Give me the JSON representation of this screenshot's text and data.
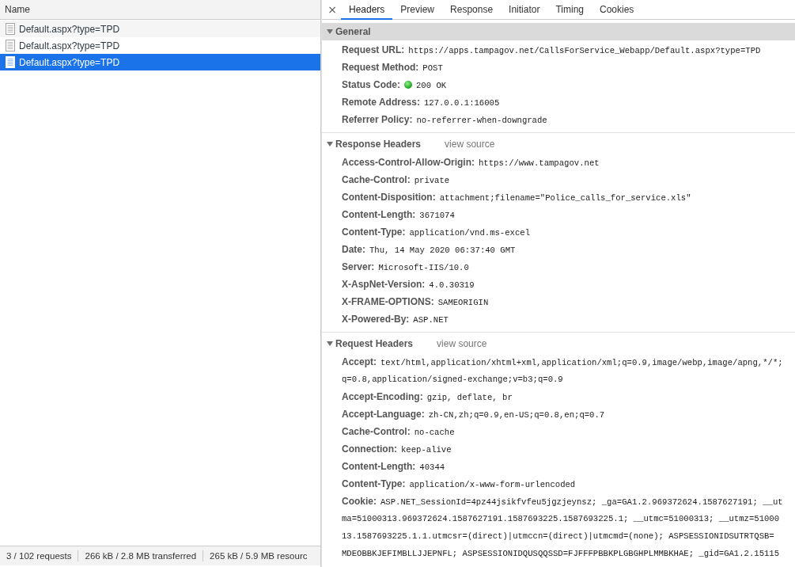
{
  "request_list": {
    "column_header": "Name",
    "requests": [
      {
        "name": "Default.aspx?type=TPD",
        "selected": false
      },
      {
        "name": "Default.aspx?type=TPD",
        "selected": false
      },
      {
        "name": "Default.aspx?type=TPD",
        "selected": true
      }
    ]
  },
  "status_bar": {
    "items": [
      "3 / 102 requests",
      "266 kB / 2.8 MB transferred",
      "265 kB / 5.9 MB resourc"
    ]
  },
  "details": {
    "close_button": "×",
    "tabs": [
      {
        "label": "Headers",
        "selected": true
      },
      {
        "label": "Preview",
        "selected": false
      },
      {
        "label": "Response",
        "selected": false
      },
      {
        "label": "Initiator",
        "selected": false
      },
      {
        "label": "Timing",
        "selected": false
      },
      {
        "label": "Cookies",
        "selected": false
      }
    ],
    "sections": [
      {
        "title": "General",
        "expanded": true,
        "selected": true,
        "rows": [
          {
            "kind": "plain",
            "name": "Request URL:",
            "value": "https://apps.tampagov.net/CallsForService_Webapp/Default.aspx?type=TPD"
          },
          {
            "kind": "plain",
            "name": "Request Method:",
            "value": "POST"
          },
          {
            "kind": "status",
            "name": "Status Code:",
            "value": "200 OK"
          },
          {
            "kind": "plain",
            "name": "Remote Address:",
            "value": "127.0.0.1:16005"
          },
          {
            "kind": "plain",
            "name": "Referrer Policy:",
            "value": "no-referrer-when-downgrade"
          }
        ]
      },
      {
        "title": "Response Headers",
        "link": "view source",
        "expanded": true,
        "selected": false,
        "rows": [
          {
            "kind": "plain",
            "name": "Access-Control-Allow-Origin:",
            "value": "https://www.tampagov.net"
          },
          {
            "kind": "plain",
            "name": "Cache-Control:",
            "value": "private"
          },
          {
            "kind": "plain",
            "name": "Content-Disposition:",
            "value": "attachment;filename=\"Police_calls_for_service.xls\""
          },
          {
            "kind": "plain",
            "name": "Content-Length:",
            "value": "3671074"
          },
          {
            "kind": "plain",
            "name": "Content-Type:",
            "value": "application/vnd.ms-excel"
          },
          {
            "kind": "plain",
            "name": "Date:",
            "value": "Thu, 14 May 2020 06:37:40 GMT"
          },
          {
            "kind": "plain",
            "name": "Server:",
            "value": "Microsoft-IIS/10.0"
          },
          {
            "kind": "plain",
            "name": "X-AspNet-Version:",
            "value": "4.0.30319"
          },
          {
            "kind": "plain",
            "name": "X-FRAME-OPTIONS:",
            "value": "SAMEORIGIN"
          },
          {
            "kind": "plain",
            "name": "X-Powered-By:",
            "value": "ASP.NET"
          }
        ]
      },
      {
        "title": "Request Headers",
        "link": "view source",
        "expanded": true,
        "selected": false,
        "rows": [
          {
            "kind": "plain",
            "name": "Accept:",
            "value": "text/html,application/xhtml+xml,application/xml;q=0.9,image/webp,image/apng,*/*;",
            "more_lines": [
              "q=0.8,application/signed-exchange;v=b3;q=0.9"
            ]
          },
          {
            "kind": "plain",
            "name": "Accept-Encoding:",
            "value": "gzip, deflate, br"
          },
          {
            "kind": "plain",
            "name": "Accept-Language:",
            "value": "zh-CN,zh;q=0.9,en-US;q=0.8,en;q=0.7"
          },
          {
            "kind": "plain",
            "name": "Cache-Control:",
            "value": "no-cache"
          },
          {
            "kind": "plain",
            "name": "Connection:",
            "value": "keep-alive"
          },
          {
            "kind": "plain",
            "name": "Content-Length:",
            "value": "40344"
          },
          {
            "kind": "plain",
            "name": "Content-Type:",
            "value": "application/x-www-form-urlencoded"
          },
          {
            "kind": "plain",
            "name": "Cookie:",
            "value": "ASP.NET_SessionId=4pz44jsikfvfeu5jgzjeynsz; _ga=GA1.2.969372624.1587627191; __ut",
            "more_lines": [
              "ma=51000313.969372624.1587627191.1587693225.1587693225.1; __utmc=51000313; __utmz=51000",
              "13.1587693225.1.1.utmcsr=(direct)|utmccn=(direct)|utmcmd=(none); ASPSESSIONIDSUTRTQSB=",
              "MDEOBBKJEFIMBLLJJEPNFL; ASPSESSIONIDQUSQQSSD=FJFFFPBBKPLGBGHPLMMBKHAE; _gid=GA1.2.15115"
            ]
          }
        ]
      }
    ]
  }
}
